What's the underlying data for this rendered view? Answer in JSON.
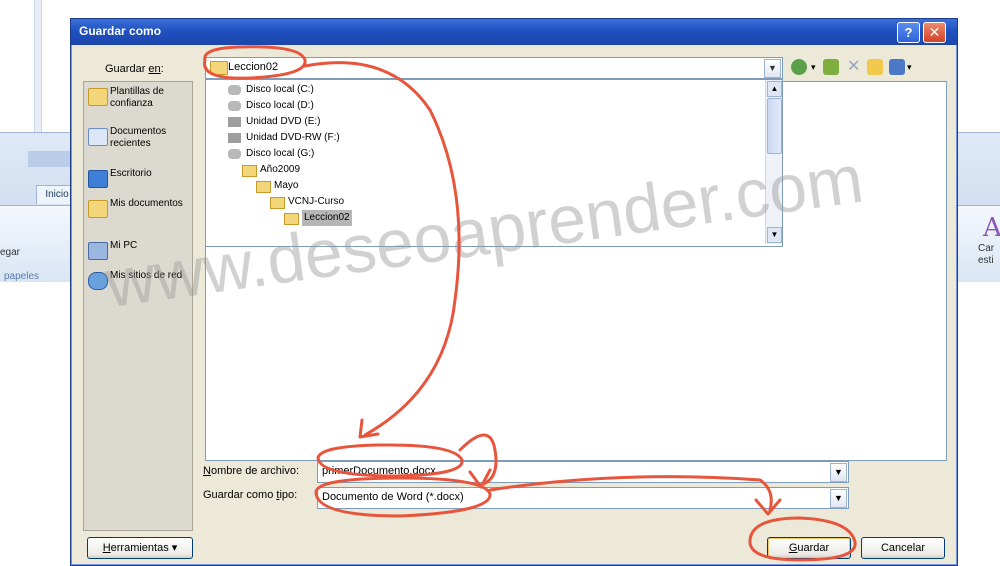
{
  "background_word": {
    "tab_label": "Inicio",
    "pegar_label": "egar",
    "papeles_label": "papeles",
    "estilos_label_1": "Car",
    "estilos_label_2": "esti"
  },
  "dialog": {
    "title": "Guardar como",
    "help_glyph": "?",
    "close_glyph": "✕"
  },
  "save_in": {
    "label_prefix": "Guardar ",
    "label_underlined": "en",
    "label_suffix": ":",
    "value": "Leccion02"
  },
  "places": [
    {
      "label": "Plantillas de confianza",
      "icon": "templates-folder-icon"
    },
    {
      "label": "Documentos recientes",
      "icon": "recent-documents-icon"
    },
    {
      "label": "Escritorio",
      "icon": "desktop-icon"
    },
    {
      "label": "Mis documentos",
      "icon": "my-documents-icon"
    },
    {
      "label": "Mi PC",
      "icon": "my-computer-icon"
    },
    {
      "label": "Mis sitios de red",
      "icon": "network-places-icon"
    }
  ],
  "location_dropdown": [
    {
      "label": "Disco local (C:)",
      "icon": "drive-icon"
    },
    {
      "label": "Disco local (D:)",
      "icon": "drive-icon"
    },
    {
      "label": "Unidad DVD (E:)",
      "icon": "dvd-drive-icon"
    },
    {
      "label": "Unidad DVD-RW (F:)",
      "icon": "dvd-drive-icon"
    },
    {
      "label": "Disco local (G:)",
      "icon": "drive-icon"
    },
    {
      "label": "Año2009",
      "icon": "folder-icon"
    },
    {
      "label": "Mayo",
      "icon": "folder-icon"
    },
    {
      "label": "VCNJ-Curso",
      "icon": "folder-icon"
    },
    {
      "label": "Leccion02",
      "icon": "folder-icon",
      "selected": true
    }
  ],
  "filename": {
    "label_underlined": "N",
    "label_rest": "ombre de archivo:",
    "value": "primerDocumento.docx"
  },
  "filetype": {
    "label_prefix": "Guardar como ",
    "label_underlined": "t",
    "label_rest": "ipo:",
    "value": "Documento de Word (*.docx)"
  },
  "buttons": {
    "tools_underlined": "H",
    "tools_rest": "erramientas",
    "tools_arrow": "▾",
    "save_underlined": "G",
    "save_rest": "uardar",
    "cancel": "Cancelar"
  },
  "watermark": "www.deseoaprender.com",
  "colors": {
    "annotation": "#e8553d",
    "titlebar": "#1f4fbf",
    "dialog_bg": "#ece9d8"
  }
}
